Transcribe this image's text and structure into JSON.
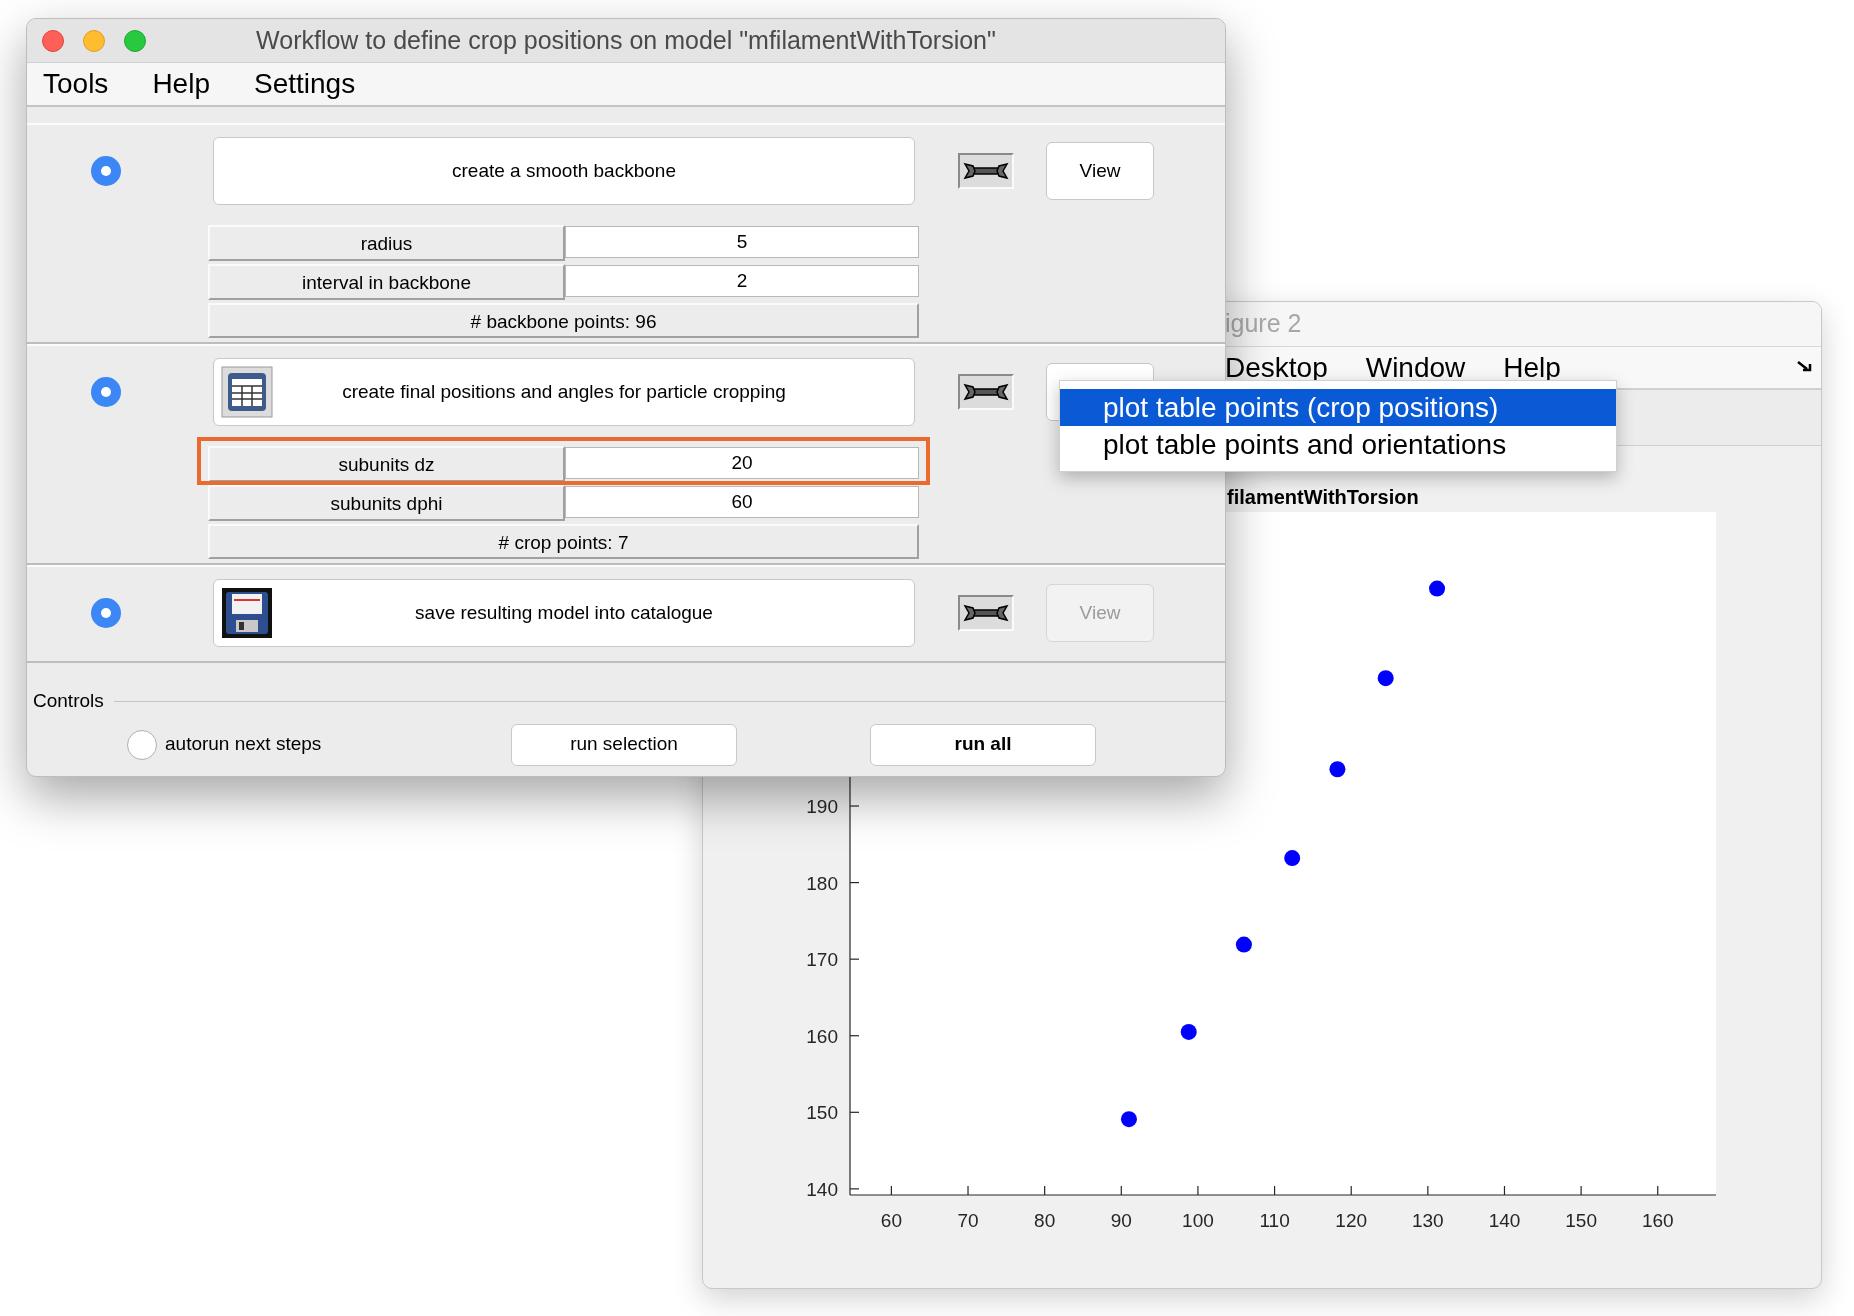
{
  "figure_window": {
    "title": "igure 2",
    "menu": [
      "Desktop",
      "Window",
      "Help"
    ],
    "axes_title": "filamentWithTorsion",
    "chart_data": {
      "type": "scatter",
      "x": [
        91,
        98.8,
        106,
        112.3,
        118.2,
        124.5,
        131.2
      ],
      "series": [
        {
          "color": "#0000ff",
          "values": [
            149.1,
            160.5,
            171.9,
            183.2,
            194.8,
            206.7,
            218.4
          ]
        }
      ],
      "xlim": [
        54.6,
        167.6
      ],
      "ylim": [
        139.2,
        228.4
      ],
      "xticks": [
        60,
        70,
        80,
        90,
        100,
        110,
        120,
        130,
        140,
        150,
        160
      ],
      "yticks": [
        140,
        150,
        160,
        170,
        180,
        190
      ]
    }
  },
  "workflow_window": {
    "title": "Workflow to define crop positions on model \"mfilamentWithTorsion\"",
    "menu": [
      "Tools",
      "Help",
      "Settings"
    ],
    "steps": [
      {
        "selected": true,
        "label": "create a smooth backbone",
        "view": {
          "label": "View",
          "disabled": false
        },
        "params": [
          {
            "label": "radius",
            "value": "5",
            "highlighted": false
          },
          {
            "label": "interval in backbone",
            "value": "2",
            "highlighted": false
          }
        ],
        "summary": "# backbone points: 96"
      },
      {
        "selected": true,
        "label": "create final positions and angles for particle cropping",
        "view": {
          "disabled": false
        },
        "params": [
          {
            "label": "subunits dz",
            "value": "20",
            "highlighted": true
          },
          {
            "label": "subunits dphi",
            "value": "60",
            "highlighted": false
          }
        ],
        "summary": "# crop points: 7"
      },
      {
        "selected": true,
        "label": "save resulting model into catalogue",
        "view": {
          "label": "View",
          "disabled": true
        }
      }
    ],
    "controls": {
      "title": "Controls",
      "autorun": {
        "label": "autorun next steps",
        "checked": false
      },
      "buttons": [
        {
          "label": "run selection",
          "default": false
        },
        {
          "label": "run all",
          "default": true
        }
      ]
    }
  },
  "popup_menu": {
    "items": [
      {
        "label": "plot table points (crop positions)",
        "selected": true
      },
      {
        "label": "plot table points and orientations",
        "selected": false
      }
    ]
  }
}
